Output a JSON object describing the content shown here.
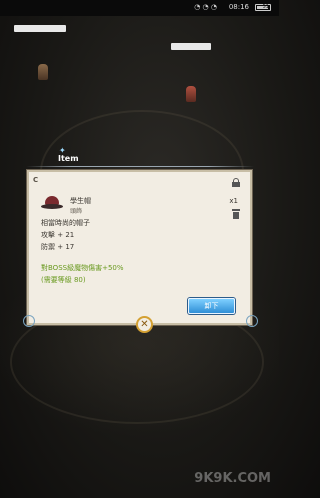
{
  "status_bar": {
    "time": "08:16",
    "signal": "◔ ◔ ◔",
    "battery": "51"
  },
  "item_header": {
    "title": "Item"
  },
  "dialog": {
    "corner_letter": "C",
    "item_name": "學生帽",
    "item_type": "頭飾",
    "description": "相當時尚的帽子",
    "stats": [
      "攻擊 + 21",
      "防禦 + 17"
    ],
    "bonus": "對BOSS級魔物傷害+50%",
    "requirement": "(需要等級 80)",
    "count": "x1",
    "equip_label": "卸下"
  },
  "close_label": "✕",
  "watermark": "9K9K.COM",
  "colors": {
    "panel_bg": "#f2ede3",
    "bonus_text": "#6a9a20",
    "button_blue": "#2f8fd6",
    "close_border": "#d4a032"
  }
}
